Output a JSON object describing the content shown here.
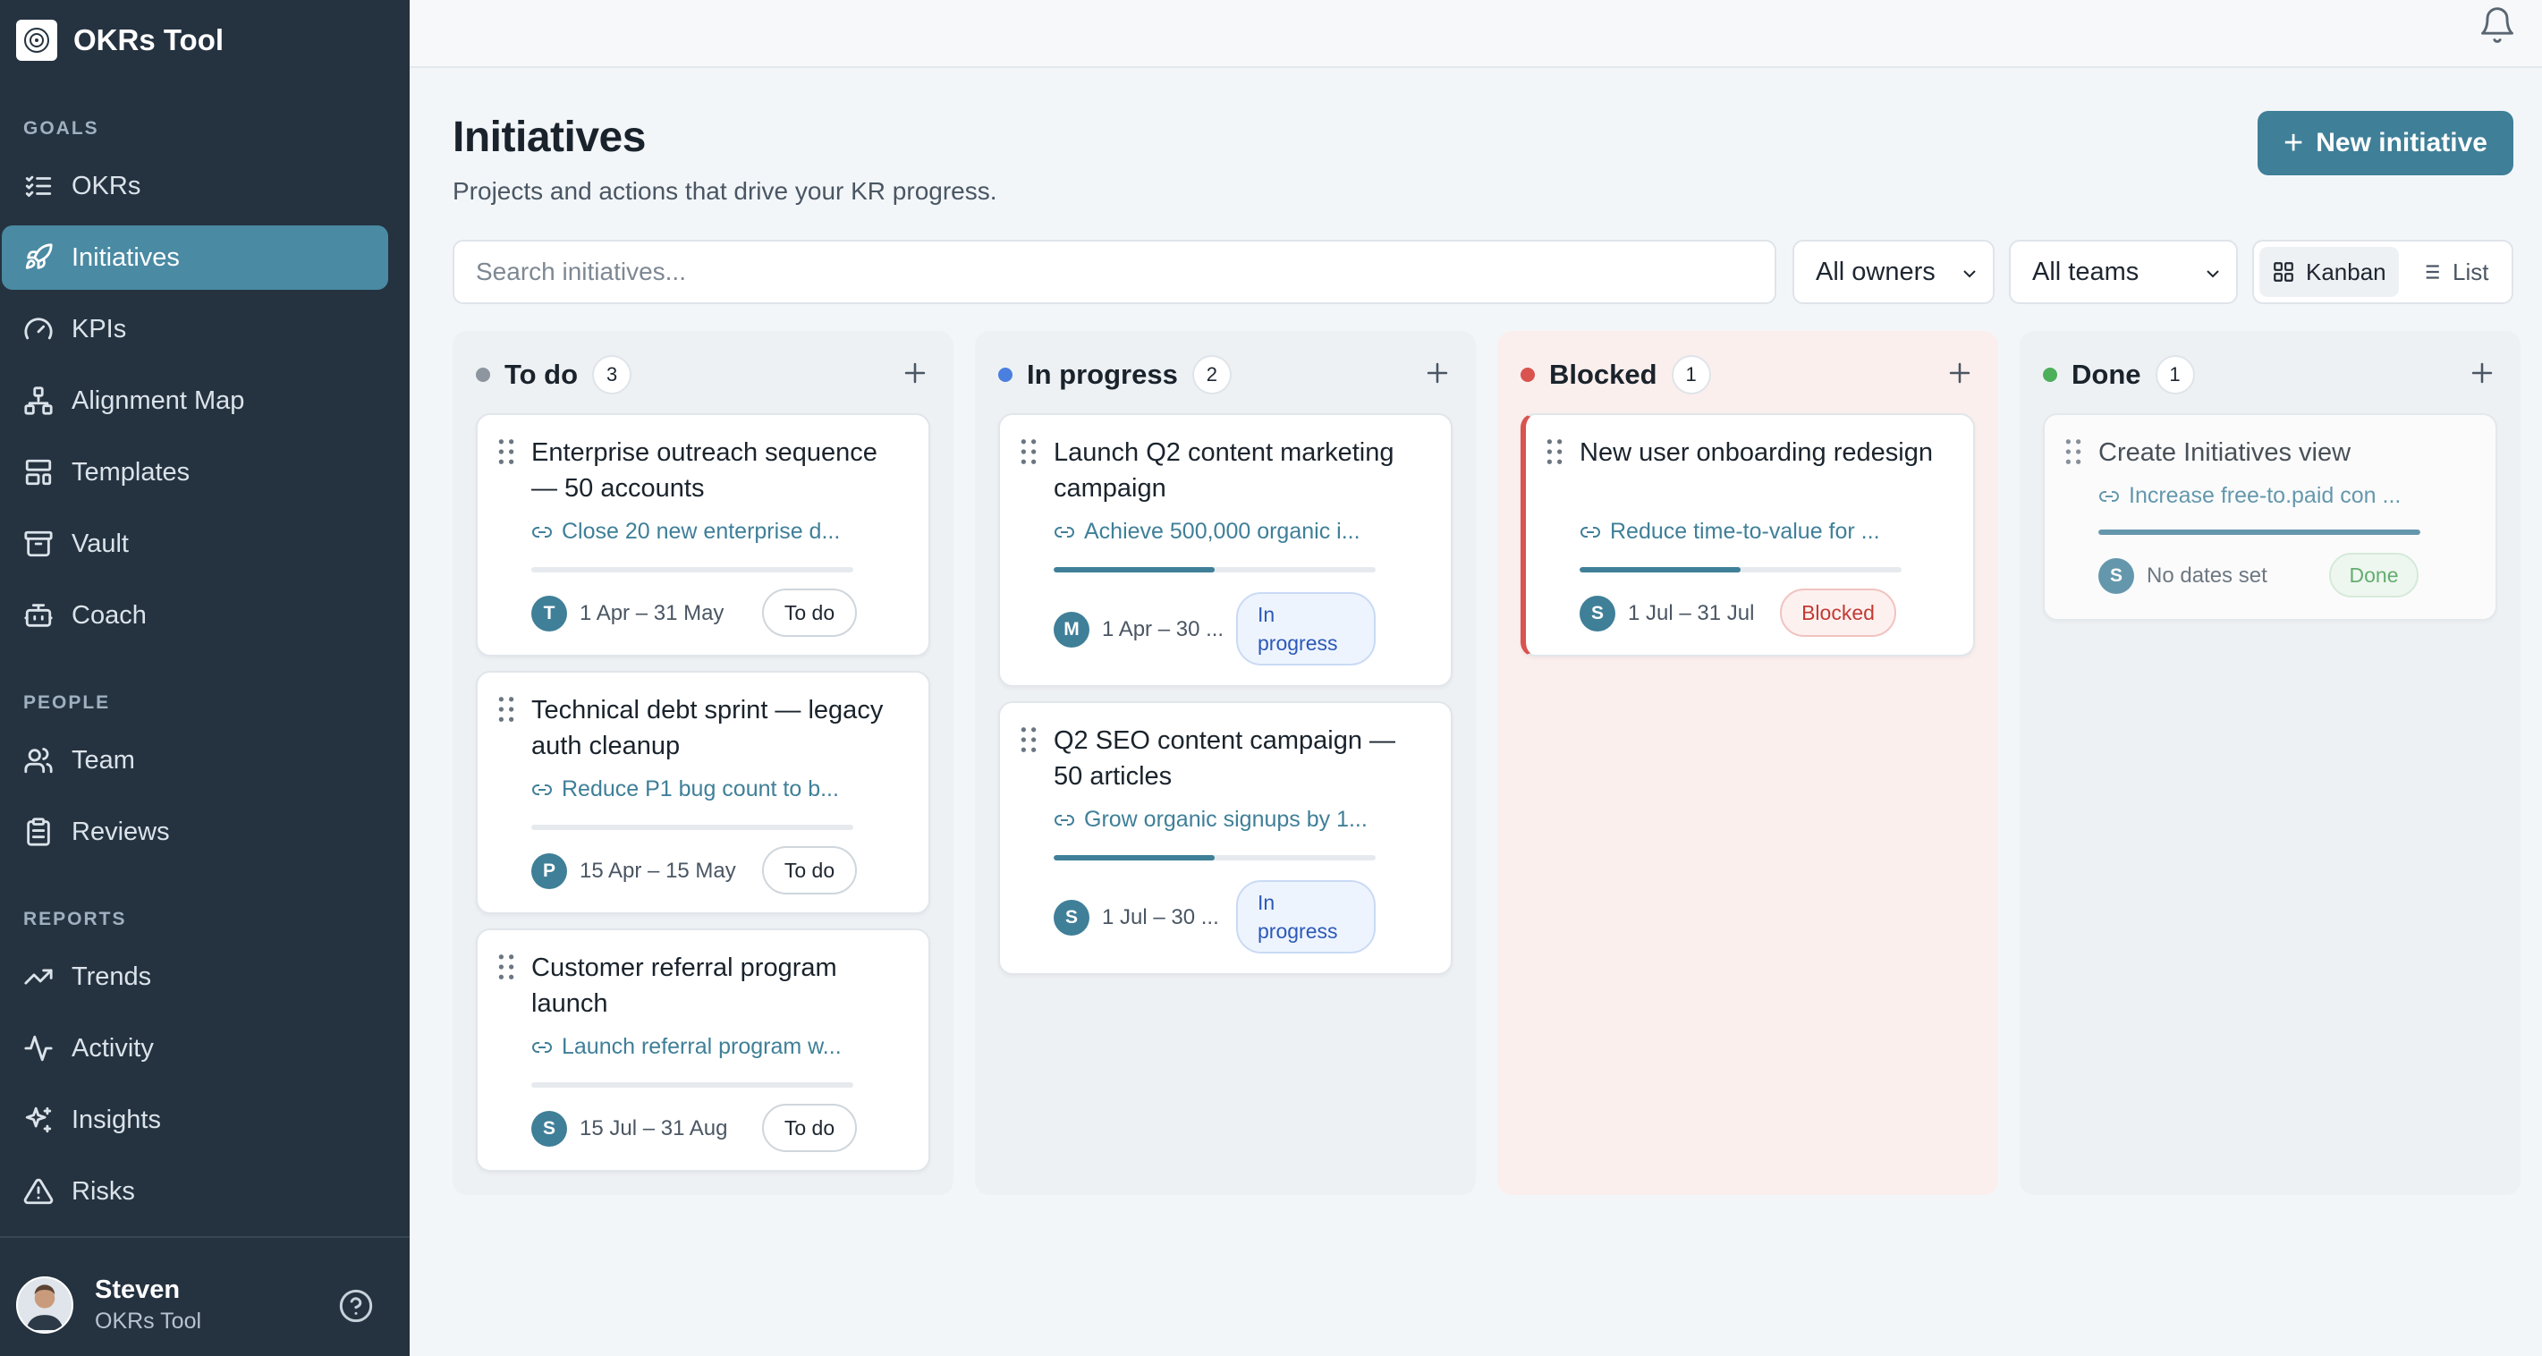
{
  "app": {
    "name": "OKRs Tool"
  },
  "sidebar": {
    "sections": {
      "goals": "GOALS",
      "people": "PEOPLE",
      "reports": "REPORTS"
    },
    "items": {
      "okrs": "OKRs",
      "initiatives": "Initiatives",
      "kpis": "KPIs",
      "alignment_map": "Alignment Map",
      "templates": "Templates",
      "vault": "Vault",
      "coach": "Coach",
      "team": "Team",
      "reviews": "Reviews",
      "trends": "Trends",
      "activity": "Activity",
      "insights": "Insights",
      "risks": "Risks"
    },
    "active_item": "Initiatives",
    "user": {
      "name": "Steven",
      "org": "OKRs Tool"
    }
  },
  "header": {
    "title": "Initiatives",
    "subtitle": "Projects and actions that drive your KR progress.",
    "new_button": "New initiative"
  },
  "filters": {
    "search_placeholder": "Search initiatives...",
    "owners": "All owners",
    "teams": "All teams",
    "view_kanban": "Kanban",
    "view_list": "List",
    "active_view": "Kanban"
  },
  "board": {
    "todo": {
      "title": "To do",
      "count": "3",
      "dot_color": "#8d959e",
      "cards": [
        {
          "title": "Enterprise outreach sequence — 50 accounts",
          "kr": "Close 20 new enterprise d...",
          "owner": "T",
          "dates": "1 Apr – 31 May",
          "status": "To do",
          "progress": 0
        },
        {
          "title": "Technical debt sprint — legacy auth cleanup",
          "kr": "Reduce P1 bug count to b...",
          "owner": "P",
          "dates": "15 Apr – 15 May",
          "status": "To do",
          "progress": 0
        },
        {
          "title": "Customer referral program launch",
          "kr": "Launch referral program w...",
          "owner": "S",
          "dates": "15 Jul – 31 Aug",
          "status": "To do",
          "progress": 0
        }
      ]
    },
    "in_progress": {
      "title": "In progress",
      "count": "2",
      "dot_color": "#4a7fe0",
      "cards": [
        {
          "title": "Launch Q2 content marketing campaign",
          "kr": "Achieve 500,000 organic i...",
          "owner": "M",
          "dates": "1 Apr – 30 ...",
          "status_line1": "In",
          "status_line2": "progress",
          "progress": 0.5
        },
        {
          "title": "Q2 SEO content campaign — 50 articles",
          "kr": "Grow organic signups by 1...",
          "owner": "S",
          "dates": "1 Jul – 30 ...",
          "status_line1": "In",
          "status_line2": "progress",
          "progress": 0.5
        }
      ]
    },
    "blocked": {
      "title": "Blocked",
      "count": "1",
      "dot_color": "#d9534f",
      "cards": [
        {
          "title": "New user onboarding redesign",
          "kr": "Reduce time-to-value for ...",
          "owner": "S",
          "dates": "1 Jul – 31 Jul",
          "status": "Blocked",
          "progress": 0.5
        }
      ]
    },
    "done": {
      "title": "Done",
      "count": "1",
      "dot_color": "#4caf5a",
      "cards": [
        {
          "title": "Create Initiatives view",
          "kr": "Increase free-to.paid con ...",
          "owner": "S",
          "dates": "No dates set",
          "status": "Done",
          "progress": 1
        }
      ]
    }
  },
  "colors": {
    "sidebar_bg": "#253240",
    "accent": "#3f7f98",
    "active_nav": "#4a8aa3",
    "blocked": "#d9534f"
  }
}
